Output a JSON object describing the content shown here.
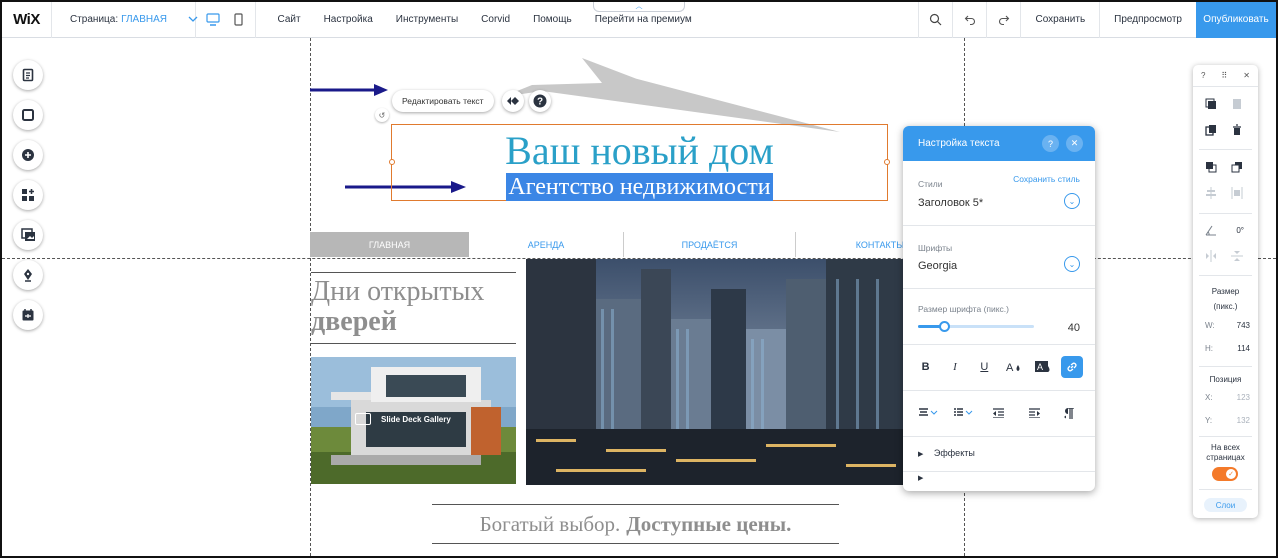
{
  "topbar": {
    "logo": "WiX",
    "page_label": "Страница:",
    "page_value": "ГЛАВНАЯ",
    "menu": [
      "Сайт",
      "Настройка",
      "Инструменты",
      "Corvid",
      "Помощь",
      "Перейти на премиум"
    ],
    "save": "Сохранить",
    "preview": "Предпросмотр",
    "publish": "Опубликовать"
  },
  "canvas": {
    "edit_text_button": "Редактировать текст",
    "heading": "Ваш новый дом",
    "subheading": "Агентство недвижимости",
    "nav": [
      "ГЛАВНАЯ",
      "АРЕНДА",
      "ПРОДАЁТСЯ",
      "КОНТАКТЫ"
    ],
    "open_days_line1": "Дни открытых",
    "open_days_line2": "дверей",
    "gallery_label": "Slide Deck Gallery",
    "tagline_normal": "Богатый выбор.",
    "tagline_bold": "Доступные цены."
  },
  "text_settings": {
    "title": "Настройка текста",
    "styles_label": "Стили",
    "save_style": "Сохранить стиль",
    "style_value": "Заголовок 5*",
    "fonts_label": "Шрифты",
    "font_value": "Georgia",
    "size_label": "Размер шрифта (пикс.)",
    "size_value": "40",
    "size_fraction": 0.22,
    "effects": "Эффекты"
  },
  "right_panel": {
    "angle": "0°",
    "size_title": "Размер",
    "size_unit": "(пикс.)",
    "w_label": "W:",
    "w_value": "743",
    "h_label": "H:",
    "h_value": "114",
    "position_title": "Позиция",
    "x_label": "X:",
    "x_value": "123",
    "y_label": "Y:",
    "y_value": "132",
    "all_pages": "На всех страницах",
    "layers": "Слои"
  },
  "colors": {
    "accent": "#3899ec",
    "heading": "#2aa0c8",
    "selection": "#3b86e5",
    "toggle": "#f47a2a"
  }
}
